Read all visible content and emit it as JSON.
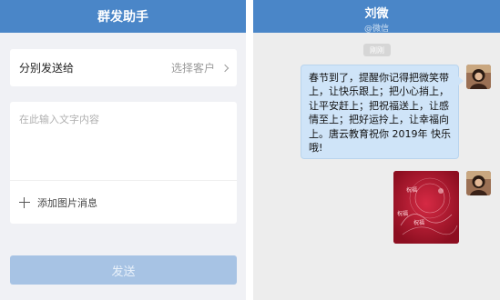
{
  "left": {
    "header_title": "群发助手",
    "send_to": {
      "label": "分别发送给",
      "action_text": "选择客户"
    },
    "message": {
      "placeholder": "在此输入文字内容",
      "add_image_label": "添加图片消息"
    },
    "send_button_label": "发送"
  },
  "right": {
    "contact_name": "刘微",
    "contact_subtitle": "@微信",
    "time_chip": "刚刚",
    "message_text": "春节到了，提醒你记得把微笑带上，让快乐跟上；把小心捎上，让平安赶上；把祝福送上，让感情至上；把好运拎上，让幸福向上。唐云教育祝你 2019年 快乐哦!",
    "image_card_text_1": "祝福",
    "image_card_text_2": "祝福",
    "image_card_text_3": "祝福"
  },
  "colors": {
    "header_blue": "#4a86c8",
    "send_button": "#a7c3e4",
    "bubble": "#cfe4f8",
    "card_red": "#b1172b"
  },
  "icons": {
    "send_to_chevron": "chevron-right-icon",
    "add_image": "plus-icon"
  }
}
